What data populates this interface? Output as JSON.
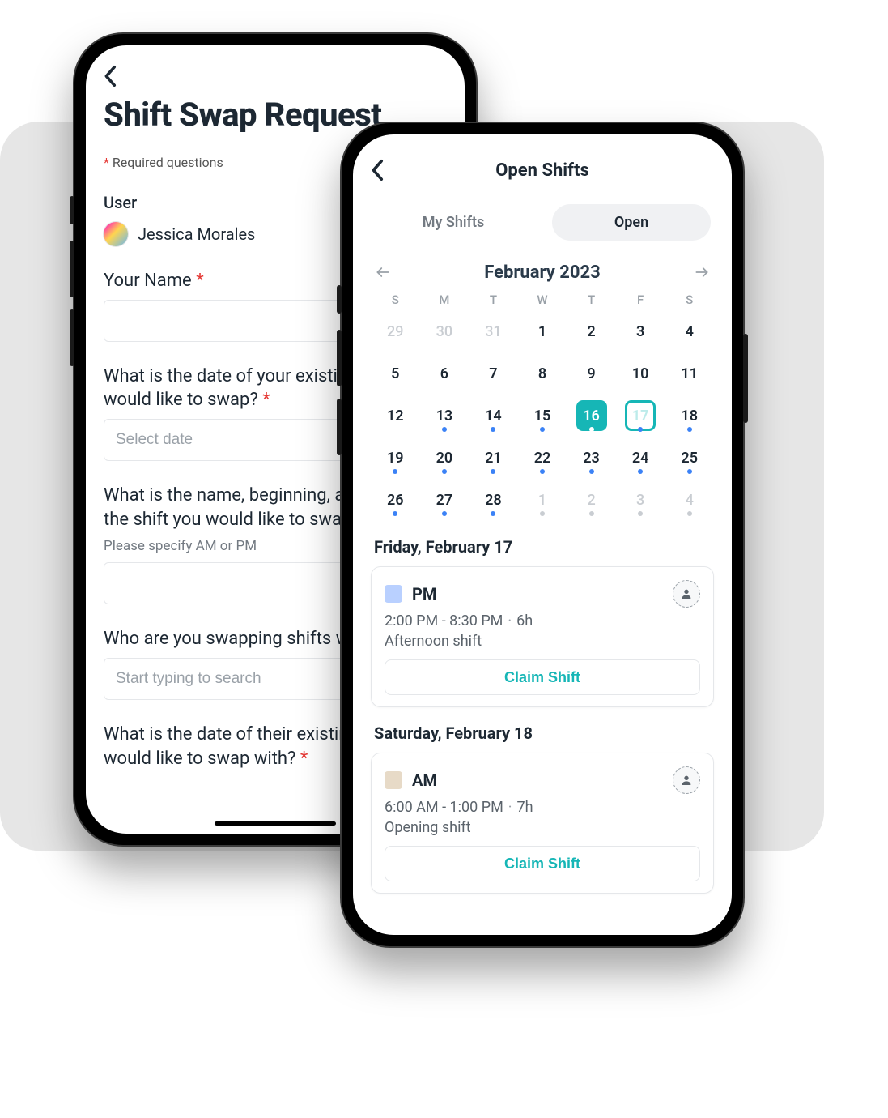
{
  "phoneA": {
    "title": "Shift Swap Request",
    "required_note_prefix": "*",
    "required_note": " Required questions",
    "user_section_label": "User",
    "user_display_name": "Jessica Morales",
    "questions": {
      "your_name": "Your Name ",
      "existing_shift_date": "What is the date of your existing shift you would like to swap? ",
      "select_date_placeholder": "Select date",
      "shift_details": "What is the name, beginning, and end of the shift you would like to swap? ",
      "shift_details_hint": "Please specify AM or PM",
      "swap_with": "Who are you swapping shifts with? ",
      "swap_with_placeholder": "Start typing to search",
      "their_shift_date": "What is the date of their existing shift you would like to swap with? "
    }
  },
  "phoneB": {
    "header_title": "Open Shifts",
    "tabs": {
      "my": "My Shifts",
      "open": "Open"
    },
    "calendar": {
      "month_label": "February 2023",
      "dow": [
        "S",
        "M",
        "T",
        "W",
        "T",
        "F",
        "S"
      ]
    },
    "shifts": [
      {
        "date_label": "Friday, February 17",
        "badge": "PM",
        "time": "2:00 PM - 8:30 PM",
        "duration": "6h",
        "desc": "Afternoon shift",
        "claim": "Claim Shift"
      },
      {
        "date_label": "Saturday, February 18",
        "badge": "AM",
        "time": "6:00 AM - 1:00 PM",
        "duration": "7h",
        "desc": "Opening shift",
        "claim": "Claim Shift"
      }
    ]
  }
}
